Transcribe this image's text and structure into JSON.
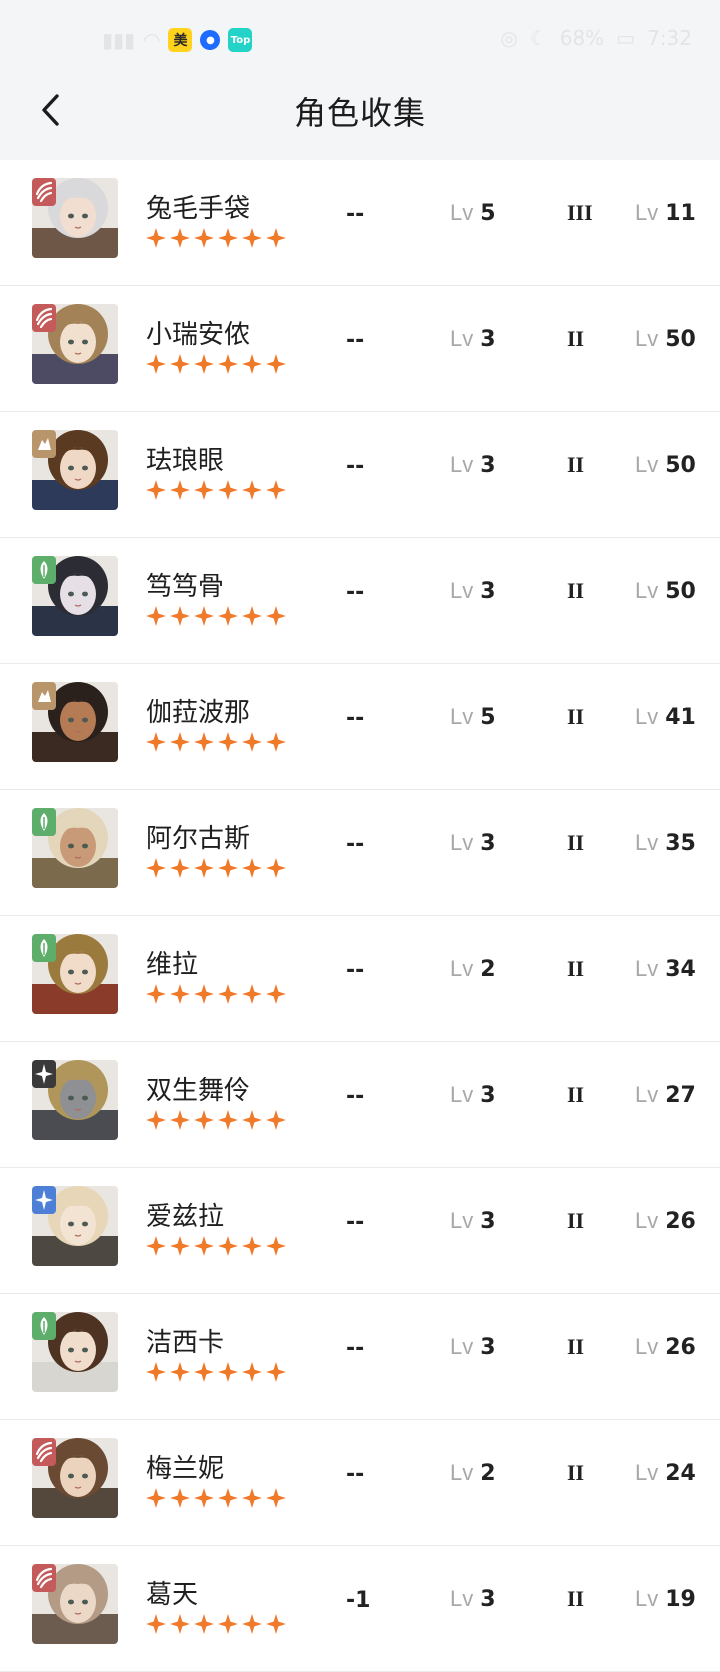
{
  "status_bar": {
    "battery": "68%",
    "time": "7:32",
    "app_badges": [
      "美",
      "Top"
    ]
  },
  "header": {
    "back_icon": "chevron-left-icon",
    "title": "角色收集"
  },
  "colors": {
    "star": "#ef7a2a",
    "elem_red": "#c45a5a",
    "elem_gold": "#b8956a",
    "elem_green": "#5cae6a",
    "elem_dark": "#3a3a3a",
    "elem_blue": "#4d7fd6"
  },
  "characters": [
    {
      "name": "兔毛手袋",
      "stars": 6,
      "dash": "--",
      "lv_label": "Lv",
      "level": "5",
      "rank": "III",
      "level2": "11",
      "element": "beast-icon",
      "elem_color": "#c45a5a",
      "hair": "#d9d9db",
      "skin": "#f1ded0",
      "outfit": "#6e5747"
    },
    {
      "name": "小瑞安侬",
      "stars": 6,
      "dash": "--",
      "lv_label": "Lv",
      "level": "3",
      "rank": "II",
      "level2": "50",
      "element": "beast-icon",
      "elem_color": "#c45a5a",
      "hair": "#a48257",
      "skin": "#f2e0cf",
      "outfit": "#4d4a63"
    },
    {
      "name": "珐琅眼",
      "stars": 6,
      "dash": "--",
      "lv_label": "Lv",
      "level": "3",
      "rank": "II",
      "level2": "50",
      "element": "mineral-icon",
      "elem_color": "#b8956a",
      "hair": "#5b3a22",
      "skin": "#efd9c6",
      "outfit": "#2d3a5a"
    },
    {
      "name": "笃笃骨",
      "stars": 6,
      "dash": "--",
      "lv_label": "Lv",
      "level": "3",
      "rank": "II",
      "level2": "50",
      "element": "plant-icon",
      "elem_color": "#5cae6a",
      "hair": "#2c2c34",
      "skin": "#e6dfe6",
      "outfit": "#2b3346"
    },
    {
      "name": "伽菈波那",
      "stars": 6,
      "dash": "--",
      "lv_label": "Lv",
      "level": "5",
      "rank": "II",
      "level2": "41",
      "element": "mineral-icon",
      "elem_color": "#b8956a",
      "hair": "#2a211c",
      "skin": "#b57b55",
      "outfit": "#3a2a22"
    },
    {
      "name": "阿尔古斯",
      "stars": 6,
      "dash": "--",
      "lv_label": "Lv",
      "level": "3",
      "rank": "II",
      "level2": "35",
      "element": "plant-icon",
      "elem_color": "#5cae6a",
      "hair": "#e3d6ba",
      "skin": "#c89a78",
      "outfit": "#7b6a4b"
    },
    {
      "name": "维拉",
      "stars": 6,
      "dash": "--",
      "lv_label": "Lv",
      "level": "2",
      "rank": "II",
      "level2": "34",
      "element": "plant-icon",
      "elem_color": "#5cae6a",
      "hair": "#9b7a3e",
      "skin": "#f0dcc8",
      "outfit": "#8a3b2a"
    },
    {
      "name": "双生舞伶",
      "stars": 6,
      "dash": "--",
      "lv_label": "Lv",
      "level": "3",
      "rank": "II",
      "level2": "27",
      "element": "spirit-icon",
      "elem_color": "#3a3a3a",
      "hair": "#b0965a",
      "skin": "#8f9094",
      "outfit": "#4a4c52"
    },
    {
      "name": "爱兹拉",
      "stars": 6,
      "dash": "--",
      "lv_label": "Lv",
      "level": "3",
      "rank": "II",
      "level2": "26",
      "element": "star-icon",
      "elem_color": "#4d7fd6",
      "hair": "#e7d6b7",
      "skin": "#f3e3d2",
      "outfit": "#4e4842"
    },
    {
      "name": "洁西卡",
      "stars": 6,
      "dash": "--",
      "lv_label": "Lv",
      "level": "3",
      "rank": "II",
      "level2": "26",
      "element": "plant-icon",
      "elem_color": "#5cae6a",
      "hair": "#4e3322",
      "skin": "#f1ddcc",
      "outfit": "#d8d6d0"
    },
    {
      "name": "梅兰妮",
      "stars": 6,
      "dash": "--",
      "lv_label": "Lv",
      "level": "2",
      "rank": "II",
      "level2": "24",
      "element": "beast-icon",
      "elem_color": "#c45a5a",
      "hair": "#6b4a33",
      "skin": "#ecd3be",
      "outfit": "#54473c"
    },
    {
      "name": "葛天",
      "stars": 6,
      "dash": "-1",
      "lv_label": "Lv",
      "level": "3",
      "rank": "II",
      "level2": "19",
      "element": "beast-icon",
      "elem_color": "#c45a5a",
      "hair": "#b39b86",
      "skin": "#ecd8c6",
      "outfit": "#6c5c50"
    }
  ]
}
